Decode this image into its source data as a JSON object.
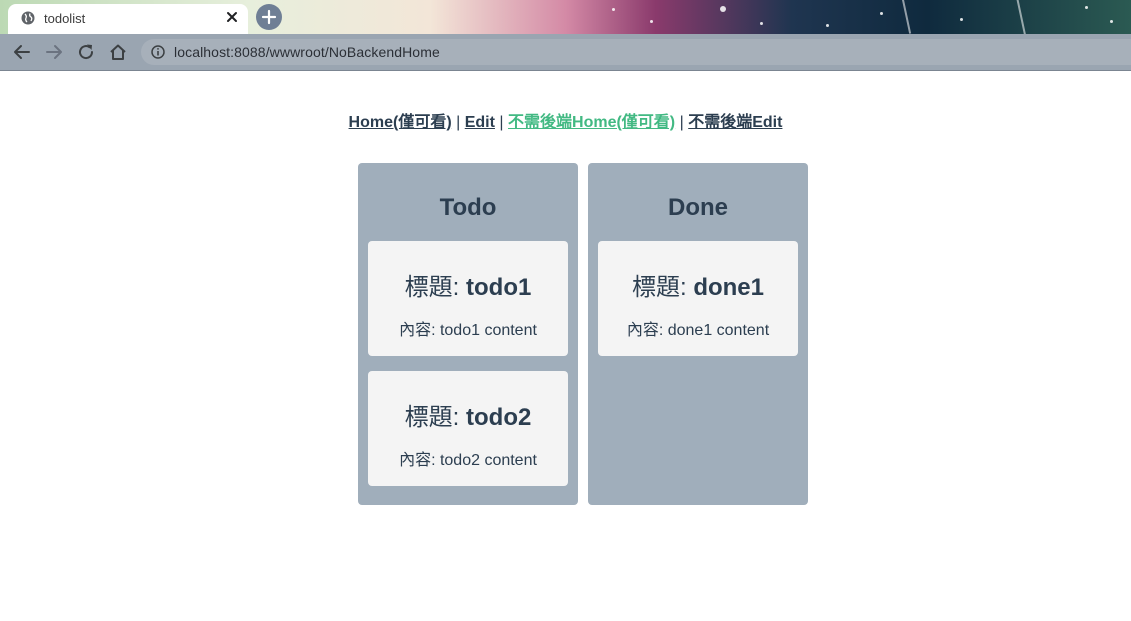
{
  "browser": {
    "tab_title": "todolist",
    "url": "localhost:8088/wwwroot/NoBackendHome"
  },
  "nav": {
    "links": [
      {
        "label": "Home(僅可看)"
      },
      {
        "label": "Edit"
      },
      {
        "label": "不需後端Home(僅可看)",
        "active": true
      },
      {
        "label": "不需後端Edit"
      }
    ],
    "separator": "|",
    "active_color": "#42b983",
    "text_color": "#2c3e50"
  },
  "board": {
    "todo": {
      "heading": "Todo",
      "cards": [
        {
          "title_prefix": "標題:",
          "title": "todo1",
          "content": "內容: todo1 content"
        },
        {
          "title_prefix": "標題:",
          "title": "todo2",
          "content": "內容: todo2 content"
        }
      ]
    },
    "done": {
      "heading": "Done",
      "cards": [
        {
          "title_prefix": "標題:",
          "title": "done1",
          "content": "內容: done1 content"
        }
      ]
    },
    "column_color": "#a0aebb",
    "card_color": "#f4f4f4"
  }
}
